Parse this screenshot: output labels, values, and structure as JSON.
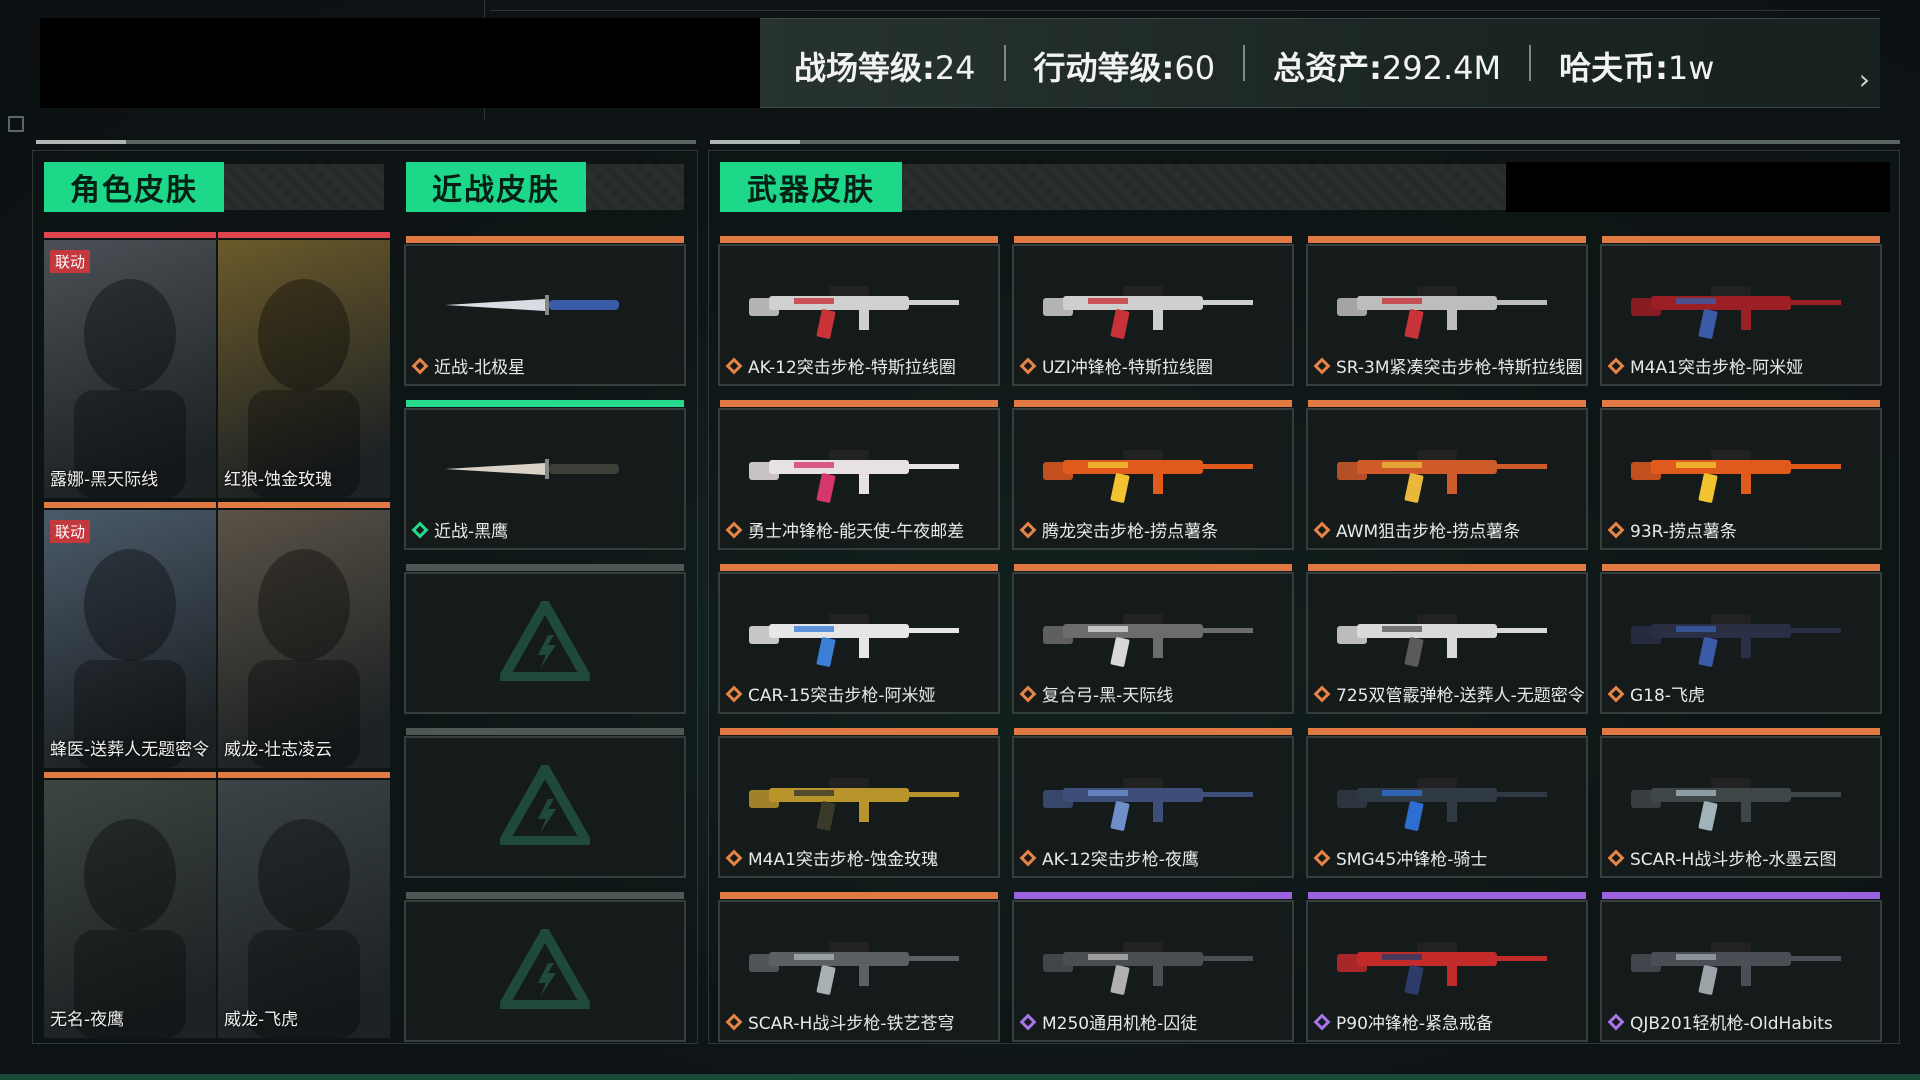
{
  "stats": [
    {
      "label": "战场等级:",
      "value": "24"
    },
    {
      "label": "行动等级:",
      "value": "60"
    },
    {
      "label": "总资产:",
      "value": "292.4M"
    },
    {
      "label": "哈夫币:",
      "value": "1w"
    }
  ],
  "tabs": {
    "character": "角色皮肤",
    "melee": "近战皮肤",
    "weapon": "武器皮肤"
  },
  "characters": [
    {
      "name": "露娜-黑天际线",
      "badge": "联动",
      "bar": "#e0454d",
      "tone": "#4a5055"
    },
    {
      "name": "红狼-蚀金玫瑰",
      "badge": "",
      "bar": "#e0454d",
      "tone": "#6b5a2a"
    },
    {
      "name": "蜂医-送葬人无题密令",
      "badge": "联动",
      "bar": "#e07a42",
      "tone": "#4b5a6a"
    },
    {
      "name": "威龙-壮志凌云",
      "badge": "",
      "bar": "#e07a42",
      "tone": "#5a5246"
    },
    {
      "name": "无名-夜鹰",
      "badge": "",
      "bar": "#e07a42",
      "tone": "#3c4640"
    },
    {
      "name": "威龙-飞虎",
      "badge": "",
      "bar": "#e07a42",
      "tone": "#3b4346"
    }
  ],
  "melee": [
    {
      "name": "近战-北极星",
      "rarity": "orange",
      "bar": "#e07a42",
      "art": "knife-blue"
    },
    {
      "name": "近战-黑鹰",
      "rarity": "green",
      "bar": "#27d98b",
      "art": "knife-dark"
    },
    {
      "name": "",
      "rarity": "none",
      "bar": "#4f5754",
      "art": "empty"
    },
    {
      "name": "",
      "rarity": "none",
      "bar": "#4f5754",
      "art": "empty"
    },
    {
      "name": "",
      "rarity": "none",
      "bar": "#4f5754",
      "art": "empty"
    }
  ],
  "weapons": [
    {
      "name": "AK-12突击步枪-特斯拉线圈",
      "rarity": "orange",
      "color": "#d0d0d0",
      "accent": "#c8333a"
    },
    {
      "name": "UZI冲锋枪-特斯拉线圈",
      "rarity": "orange",
      "color": "#cfcfcf",
      "accent": "#c8333a"
    },
    {
      "name": "SR-3M紧凑突击步枪-特斯拉线圈",
      "rarity": "orange",
      "color": "#bdbdbd",
      "accent": "#c8333a"
    },
    {
      "name": "M4A1突击步枪-阿米娅",
      "rarity": "orange",
      "color": "#9b1f25",
      "accent": "#3a5ca8"
    },
    {
      "name": "勇士冲锋枪-能天使-午夜邮差",
      "rarity": "orange",
      "color": "#e7e0e4",
      "accent": "#d4376b"
    },
    {
      "name": "腾龙突击步枪-捞点薯条",
      "rarity": "orange",
      "color": "#e05a1e",
      "accent": "#f2c230"
    },
    {
      "name": "AWM狙击步枪-捞点薯条",
      "rarity": "orange",
      "color": "#cf5a2a",
      "accent": "#e9b83a"
    },
    {
      "name": "93R-捞点薯条",
      "rarity": "orange",
      "color": "#e05a1e",
      "accent": "#f2c230"
    },
    {
      "name": "CAR-15突击步枪-阿米娅",
      "rarity": "orange",
      "color": "#e6e6e6",
      "accent": "#3b7fd6"
    },
    {
      "name": "复合弓-黑-天际线",
      "rarity": "orange",
      "color": "#6c6c6c",
      "accent": "#d8d8d8"
    },
    {
      "name": "725双管霰弹枪-送葬人-无题密令",
      "rarity": "orange",
      "color": "#d9d9d9",
      "accent": "#5a5a5a"
    },
    {
      "name": "G18-飞虎",
      "rarity": "orange",
      "color": "#2a2f45",
      "accent": "#3a5ca8"
    },
    {
      "name": "M4A1突击步枪-蚀金玫瑰",
      "rarity": "orange",
      "color": "#b8952c",
      "accent": "#3a3a2a"
    },
    {
      "name": "AK-12突击步枪-夜鹰",
      "rarity": "orange",
      "color": "#3d4f78",
      "accent": "#6e8fc9"
    },
    {
      "name": "SMG45冲锋枪-骑士",
      "rarity": "orange",
      "color": "#2f3a45",
      "accent": "#2d6fd0"
    },
    {
      "name": "SCAR-H战斗步枪-水墨云图",
      "rarity": "orange",
      "color": "#3f4648",
      "accent": "#9fb3b8"
    },
    {
      "name": "SCAR-H战斗步枪-铁艺苍穹",
      "rarity": "orange",
      "color": "#5a6064",
      "accent": "#a9b0b4"
    },
    {
      "name": "M250通用机枪-囚徒",
      "rarity": "purple",
      "color": "#4a4e52",
      "accent": "#b0b0b0"
    },
    {
      "name": "P90冲锋枪-紧急戒备",
      "rarity": "purple",
      "color": "#c32a2a",
      "accent": "#2d3c6a"
    },
    {
      "name": "QJB201轻机枪-OldHabits",
      "rarity": "purple",
      "color": "#4a4f55",
      "accent": "#9ca4aa"
    }
  ]
}
